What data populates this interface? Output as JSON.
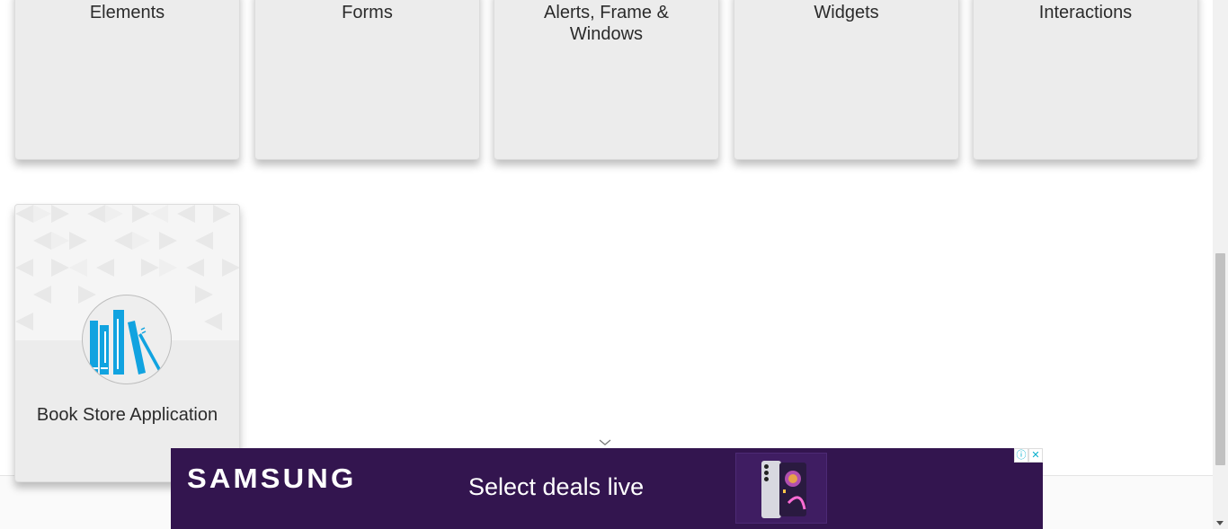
{
  "cards": [
    {
      "title_line1": "Elements",
      "title_line2": ""
    },
    {
      "title_line1": "Forms",
      "title_line2": ""
    },
    {
      "title_line1": "Alerts, Frame &",
      "title_line2": "Windows"
    },
    {
      "title_line1": "Widgets",
      "title_line2": ""
    },
    {
      "title_line1": "Interactions",
      "title_line2": ""
    }
  ],
  "book_card": {
    "title": "Book Store Application",
    "icon": "books-icon"
  },
  "ad": {
    "brand": "SAMSUNG",
    "tagline": "Select deals live",
    "info_icon": "ⓘ",
    "close_icon": "✕",
    "background": "#33154f"
  },
  "icons": {
    "collapse": "chevron-down-icon"
  }
}
